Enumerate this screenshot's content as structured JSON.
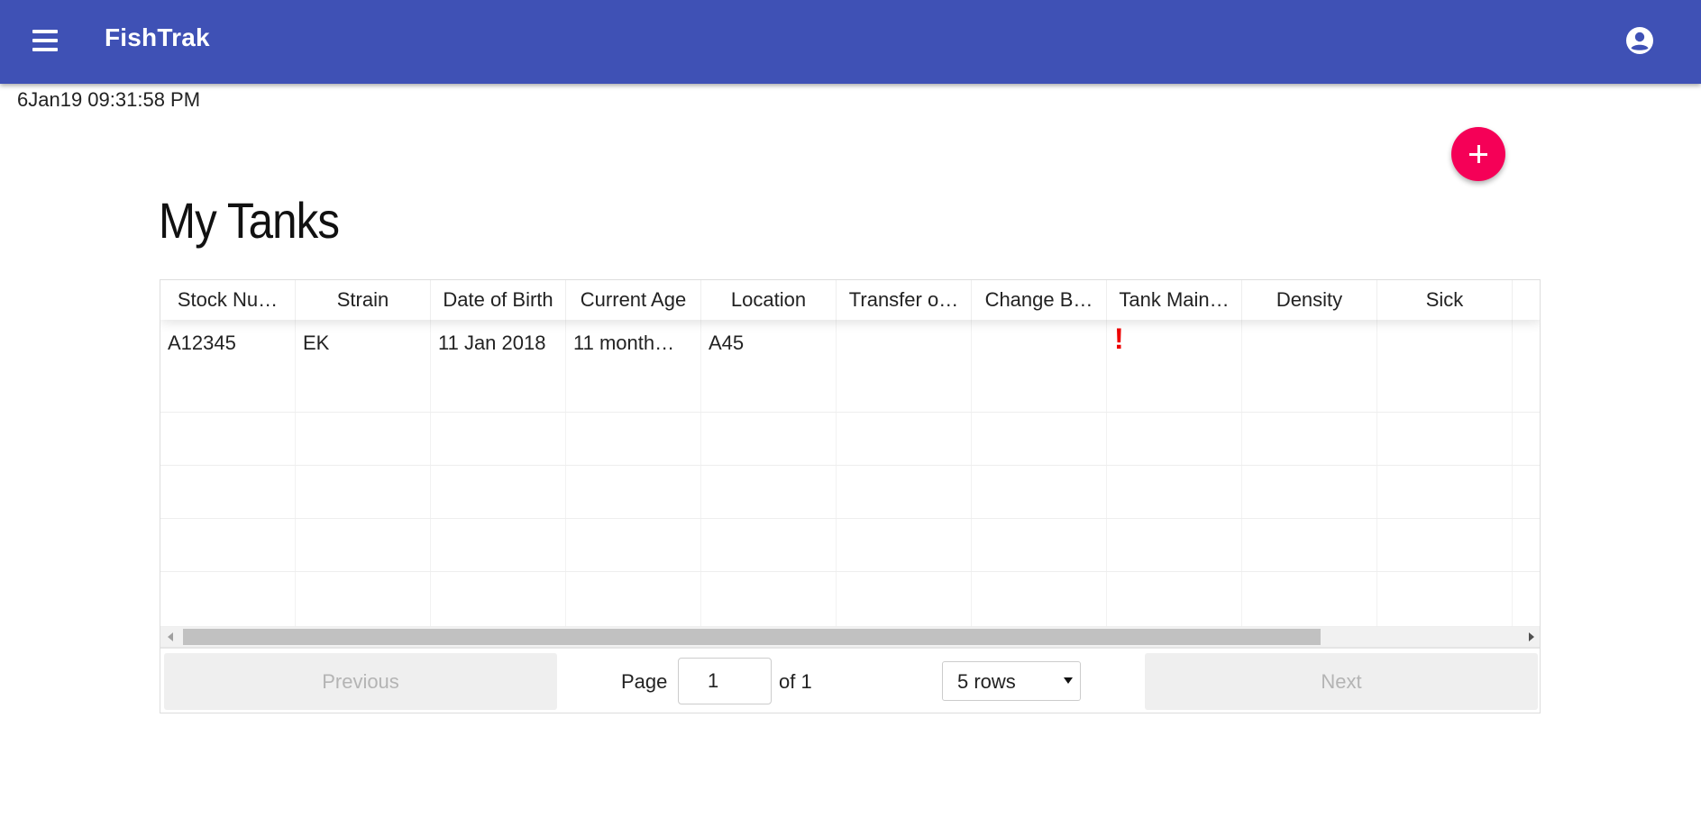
{
  "app": {
    "title": "FishTrak"
  },
  "timestamp": "6Jan19 09:31:58 PM",
  "page": {
    "title": "My Tanks"
  },
  "icons": {
    "menu": "menu-icon",
    "account": "account-circle-icon",
    "add": "plus-icon",
    "alert": "exclamation-icon"
  },
  "colors": {
    "appbar": "#3f51b5",
    "fab": "#f50057",
    "alert": "#e00000"
  },
  "table": {
    "columns": [
      "Stock Nu…",
      "Strain",
      "Date of Birth",
      "Current Age",
      "Location",
      "Transfer o…",
      "Change B…",
      "Tank Main…",
      "Density",
      "Sick"
    ],
    "rows": [
      [
        "A12345",
        "EK",
        "11 Jan 2018",
        "11 month…",
        "A45",
        "",
        "",
        "!",
        "",
        ""
      ]
    ]
  },
  "pagination": {
    "previous_label": "Previous",
    "page_label": "Page",
    "page_value": "1",
    "of_label": "of 1",
    "rows_select": "5 rows",
    "next_label": "Next"
  }
}
